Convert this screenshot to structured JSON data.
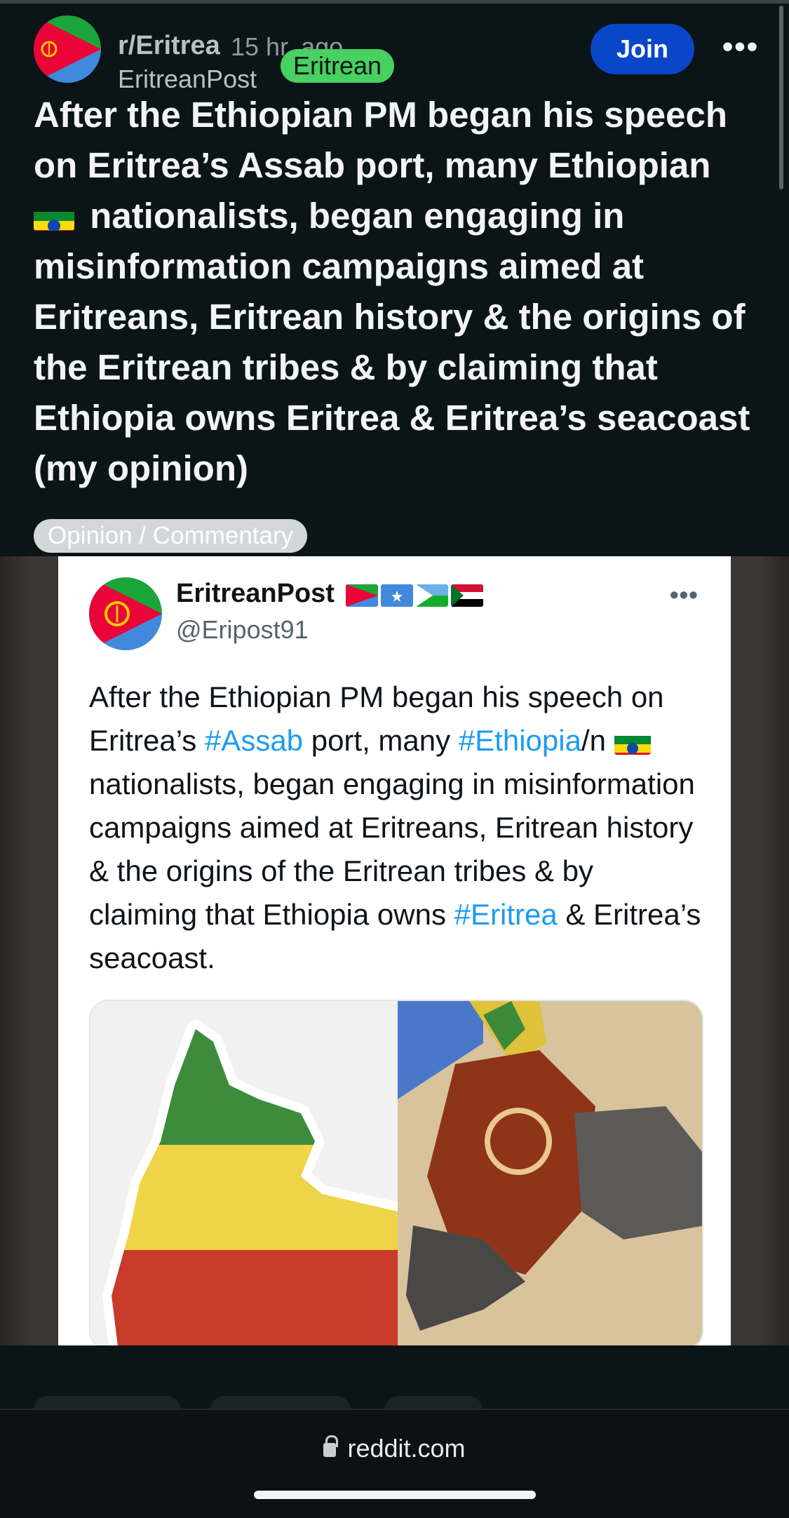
{
  "post": {
    "subreddit": "r/Eritrea",
    "time_ago": "15 hr. ago",
    "author": "EritreanPost",
    "user_flair": "Eritrean",
    "join_label": "Join",
    "more_label": "•••",
    "title": "After the Ethiopian PM began his speech on Eritrea’s Assab port, many Ethiopian",
    "title_after_flag": "nationalists, began engaging in misinformation campaigns aimed at Eritreans, Eritrean history & the origins of the Eritrean tribes & by claiming that Ethiopia owns Eritrea & Eritrea’s seacoast (my opinion)",
    "post_flair": "Opinion / Commentary"
  },
  "tweet": {
    "name": "EritreanPost",
    "handle": "@Eripost91",
    "more_label": "•••",
    "text_1": "After the Ethiopian PM began his speech on Eritrea’s ",
    "tag_1": "#Assab",
    "text_2": " port, many ",
    "tag_2": "#Ethiopia",
    "text_3": "/n",
    "text_4": " nationalists, began engaging in misinformation campaigns aimed at Eritreans, Eritrean history &  the origins of the Eritrean tribes & by claiming that Ethiopia owns ",
    "tag_3": "#Eritrea",
    "text_5": " & Eritrea’s seacoast.",
    "flags": [
      "eritrea-flag",
      "somalia-flag",
      "djibouti-flag",
      "sudan-flag"
    ]
  },
  "browser": {
    "url": "reddit.com"
  },
  "colors": {
    "background": "#0b1416",
    "join_button": "#0a46c8",
    "user_flair": "#46d160",
    "hashtag": "#1d9bf0"
  }
}
